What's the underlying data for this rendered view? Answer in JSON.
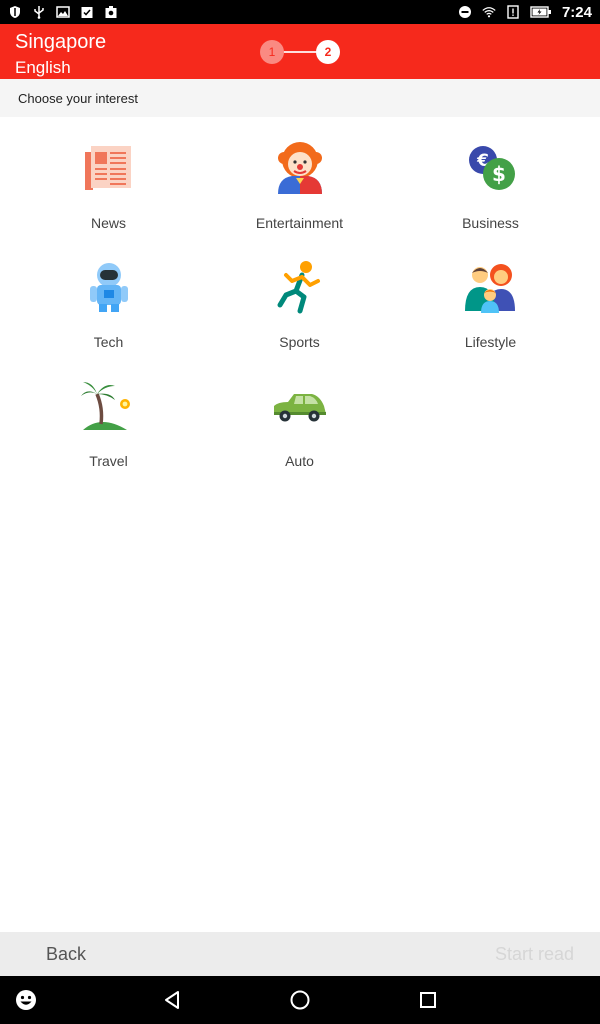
{
  "status_bar": {
    "time": "7:24",
    "left_icons": [
      "shield-icon",
      "usb-icon",
      "image-icon",
      "clipboard-check-icon",
      "camera-box-icon"
    ],
    "right_icons": [
      "do-not-disturb-icon",
      "wifi-icon",
      "alert-box-icon",
      "battery-charging-icon"
    ]
  },
  "header": {
    "country": "Singapore",
    "language": "English",
    "steps": [
      "1",
      "2"
    ],
    "active_step": 2,
    "accent_color": "#f6291c"
  },
  "subheader": {
    "text": "Choose your interest"
  },
  "interests": [
    {
      "label": "News",
      "icon": "newspaper-icon"
    },
    {
      "label": "Entertainment",
      "icon": "clown-icon"
    },
    {
      "label": "Business",
      "icon": "currency-coins-icon"
    },
    {
      "label": "Tech",
      "icon": "astronaut-icon"
    },
    {
      "label": "Sports",
      "icon": "runner-icon"
    },
    {
      "label": "Lifestyle",
      "icon": "family-icon"
    },
    {
      "label": "Travel",
      "icon": "palm-island-icon"
    },
    {
      "label": "Auto",
      "icon": "car-icon"
    }
  ],
  "bottom_bar": {
    "back_label": "Back",
    "start_label": "Start read"
  },
  "nav_bar": {
    "buttons": [
      "emoji-icon",
      "back-triangle-icon",
      "home-circle-icon",
      "recents-square-icon"
    ]
  }
}
